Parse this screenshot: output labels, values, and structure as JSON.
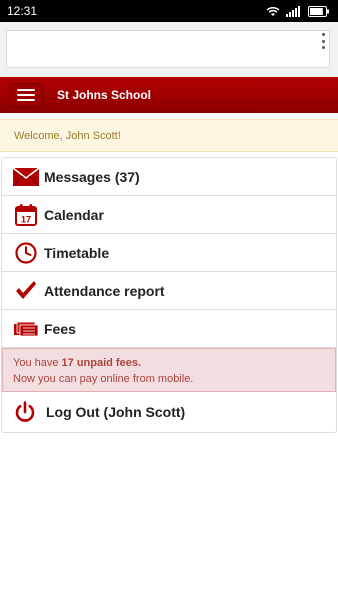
{
  "status_bar": {
    "time": "12:31",
    "battery_level_pct": 85
  },
  "browser": {
    "url_value": "",
    "menu_icon": "more-vert-icon"
  },
  "header": {
    "title": "St Johns School",
    "menu_icon": "hamburger-icon",
    "color": "#a80000"
  },
  "welcome": {
    "text": "Welcome, John Scott!"
  },
  "menu": {
    "items": [
      {
        "label": "Messages (37)",
        "icon": "envelope-icon"
      },
      {
        "label": "Calendar",
        "icon": "calendar-icon",
        "icon_text": "17"
      },
      {
        "label": "Timetable",
        "icon": "clock-icon"
      },
      {
        "label": "Attendance report",
        "icon": "checkmark-icon"
      },
      {
        "label": "Fees",
        "icon": "money-icon"
      }
    ]
  },
  "fees_alert": {
    "prefix": "You have ",
    "highlight": "17 unpaid fees.",
    "line2": "Now you can pay online from mobile."
  },
  "logout": {
    "label": "Log Out (John Scott)",
    "icon": "power-icon"
  },
  "colors": {
    "accent": "#b30000",
    "alert_bg": "#f2dede",
    "alert_text": "#a94442",
    "welcome_bg": "#fcf6e0",
    "welcome_text": "#9a7a2b"
  }
}
